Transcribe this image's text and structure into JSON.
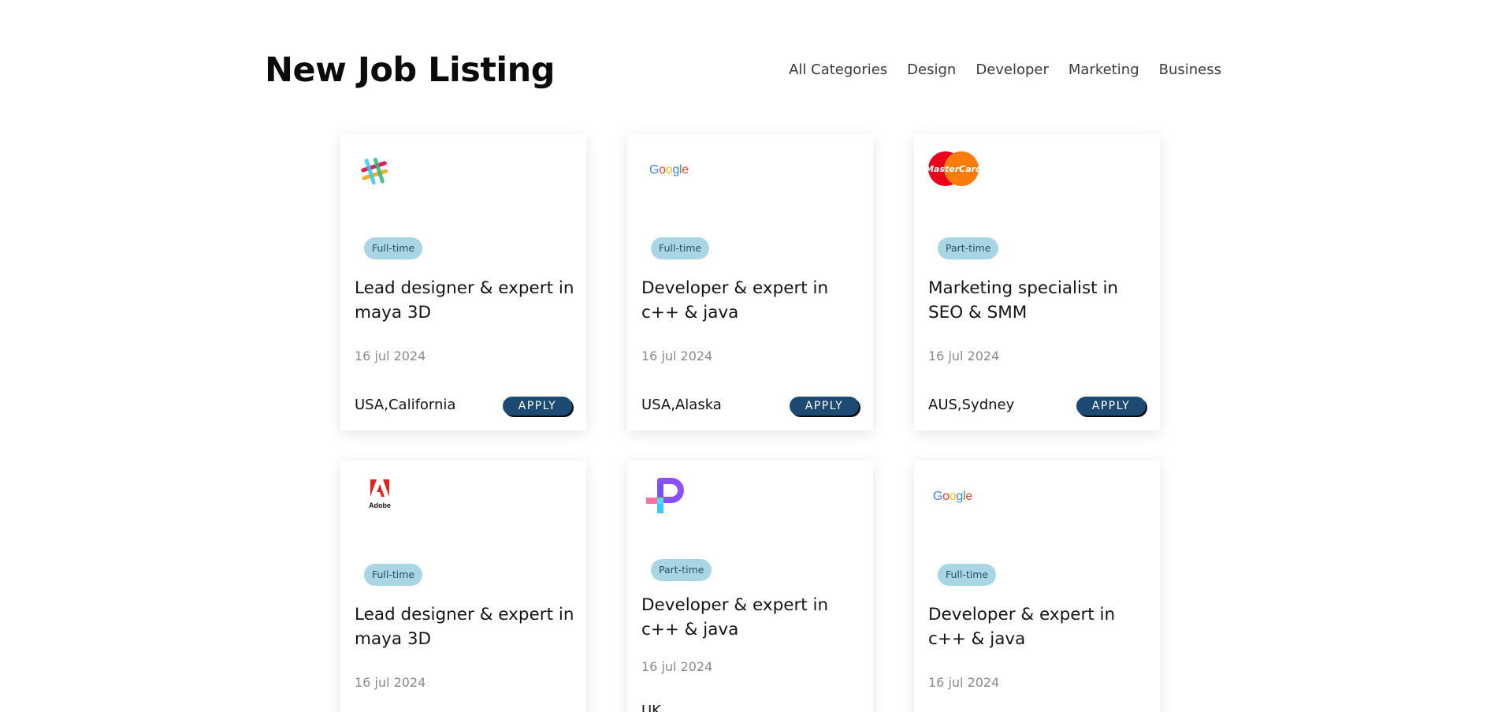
{
  "page": {
    "title": "New Job Listing"
  },
  "categories": [
    "All Categories",
    "Design",
    "Developer",
    "Marketing",
    "Business"
  ],
  "jobs": [
    {
      "logo": "slack-logo",
      "type": "Full-time",
      "title": "Lead designer & expert in maya 3D",
      "date": "16 jul 2024",
      "location": "USA,California",
      "apply_label": "APPLY"
    },
    {
      "logo": "google-logo",
      "type": "Full-time",
      "title": "Developer & expert in c++ & java",
      "date": "16 jul 2024",
      "location": "USA,Alaska",
      "apply_label": "APPLY"
    },
    {
      "logo": "mastercard-logo",
      "type": "Part-time",
      "title": "Marketing specialist in SEO & SMM",
      "date": "16 jul 2024",
      "location": "AUS,Sydney",
      "apply_label": "APPLY"
    },
    {
      "logo": "adobe-logo",
      "type": "Full-time",
      "title": "Lead designer & expert in maya 3D",
      "date": "16 jul 2024",
      "location": "",
      "apply_label": ""
    },
    {
      "logo": "pipedrive-style-logo",
      "type": "Part-time",
      "title": "Developer & expert in c++ & java",
      "date": "16 jul 2024",
      "location": "UK",
      "apply_label": ""
    },
    {
      "logo": "google-logo",
      "type": "Full-time",
      "title": "Developer & expert in c++ & java",
      "date": "16 jul 2024",
      "location": "",
      "apply_label": ""
    }
  ],
  "logos": {
    "mastercard_text": "MasterCard",
    "adobe_text": "Adobe",
    "google_text": [
      "G",
      "o",
      "o",
      "g",
      "l",
      "e"
    ]
  },
  "colors": {
    "tag_bg": "#a9d6e5",
    "tag_text": "#2a4e67",
    "apply_bg": "#1c4a73",
    "google_blue": "#4285F4",
    "google_red": "#EA4335",
    "google_yellow": "#FBBC05",
    "google_green": "#34A853"
  }
}
